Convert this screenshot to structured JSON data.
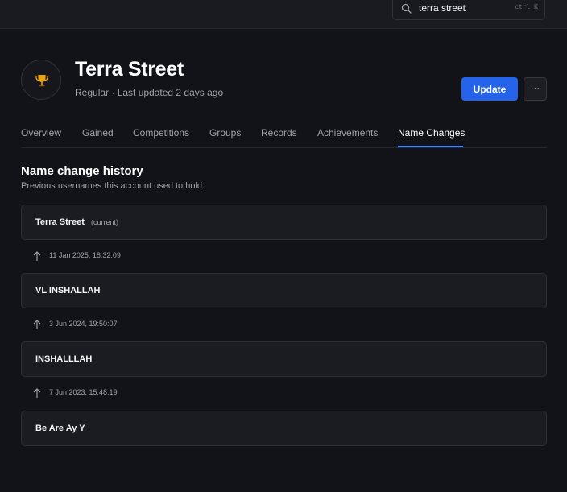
{
  "search": {
    "value": "terra street",
    "shortcut": "ctrl K"
  },
  "player": {
    "name": "Terra Street",
    "subtitle": "Regular · Last updated 2 days ago",
    "avatar_icon": "trophy-icon"
  },
  "actions": {
    "update_label": "Update",
    "more_label": "···"
  },
  "tabs": [
    {
      "label": "Overview"
    },
    {
      "label": "Gained"
    },
    {
      "label": "Competitions"
    },
    {
      "label": "Groups"
    },
    {
      "label": "Records"
    },
    {
      "label": "Achievements"
    },
    {
      "label": "Name Changes",
      "active": true
    }
  ],
  "history": {
    "title": "Name change history",
    "description": "Previous usernames this account used to hold.",
    "current_tag": "(current)",
    "names": [
      "Terra Street",
      "VL INSHALLAH",
      "INSHALLLAH",
      "Be Are Ay Y"
    ],
    "changes": [
      "11 Jan 2025, 18:32:09",
      "3 Jun 2024, 19:50:07",
      "7 Jun 2023, 15:48:19"
    ]
  },
  "colors": {
    "background": "#111318",
    "accent": "#2563eb",
    "card": "#1a1c22"
  }
}
